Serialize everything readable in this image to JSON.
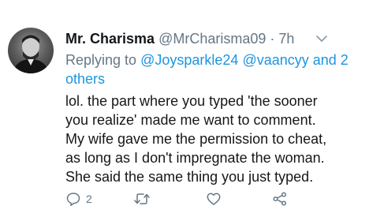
{
  "tweet": {
    "author": {
      "name": "Mr. Charisma",
      "handle": "@MrCharisma09",
      "separator": "·",
      "time": "7h"
    },
    "replying": {
      "prefix": "Replying to",
      "mention1": "@Joysparkle24",
      "mention2": "@vaancyy",
      "others": "and 2 others"
    },
    "text_lines": [
      "lol. the part where you typed 'the sooner",
      "you realize' made me want to comment.",
      "My wife gave me the permission to cheat,",
      "as long as I don't impregnate the woman.",
      "She said the same thing you just typed."
    ],
    "actions": {
      "reply_count": "2",
      "icons": [
        "reply-icon",
        "retweet-icon",
        "like-icon",
        "share-icon"
      ]
    },
    "colors": {
      "link": "#1b95e0",
      "muted": "#657786",
      "text": "#14171a"
    }
  }
}
